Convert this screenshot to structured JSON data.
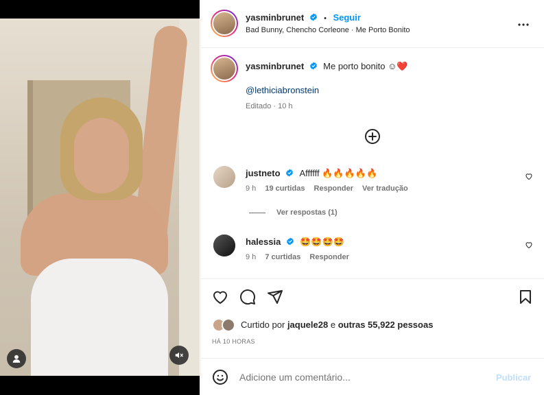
{
  "author": {
    "username": "yasminbrunet",
    "follow_label": "Seguir",
    "separator": "•",
    "audio": "Bad Bunny, Chencho Corleone · Me Porto Bonito"
  },
  "caption": {
    "username": "yasminbrunet",
    "text": "Me porto bonito ☺❤️",
    "mention": "@lethiciabronstein",
    "meta": "Editado · 10 h"
  },
  "comments": [
    {
      "username": "justneto",
      "text": "Affffff 🔥🔥🔥🔥🔥",
      "time": "9 h",
      "likes": "19 curtidas",
      "reply": "Responder",
      "translate": "Ver tradução",
      "view_replies": "Ver respostas (1)"
    },
    {
      "username": "halessia",
      "text": "🤩🤩🤩🤩",
      "time": "9 h",
      "likes": "7 curtidas",
      "reply": "Responder"
    }
  ],
  "liked_by": {
    "prefix": "Curtido por",
    "user": "jaquele28",
    "conj": "e",
    "others": "outras 55,922 pessoas"
  },
  "posted_ago": "HÁ 10 HORAS",
  "composer": {
    "placeholder": "Adicione um comentário...",
    "publish": "Publicar"
  },
  "colors": {
    "accent": "#0095f6",
    "publish_disabled": "#c0dffd",
    "verified": "#0095f6"
  }
}
